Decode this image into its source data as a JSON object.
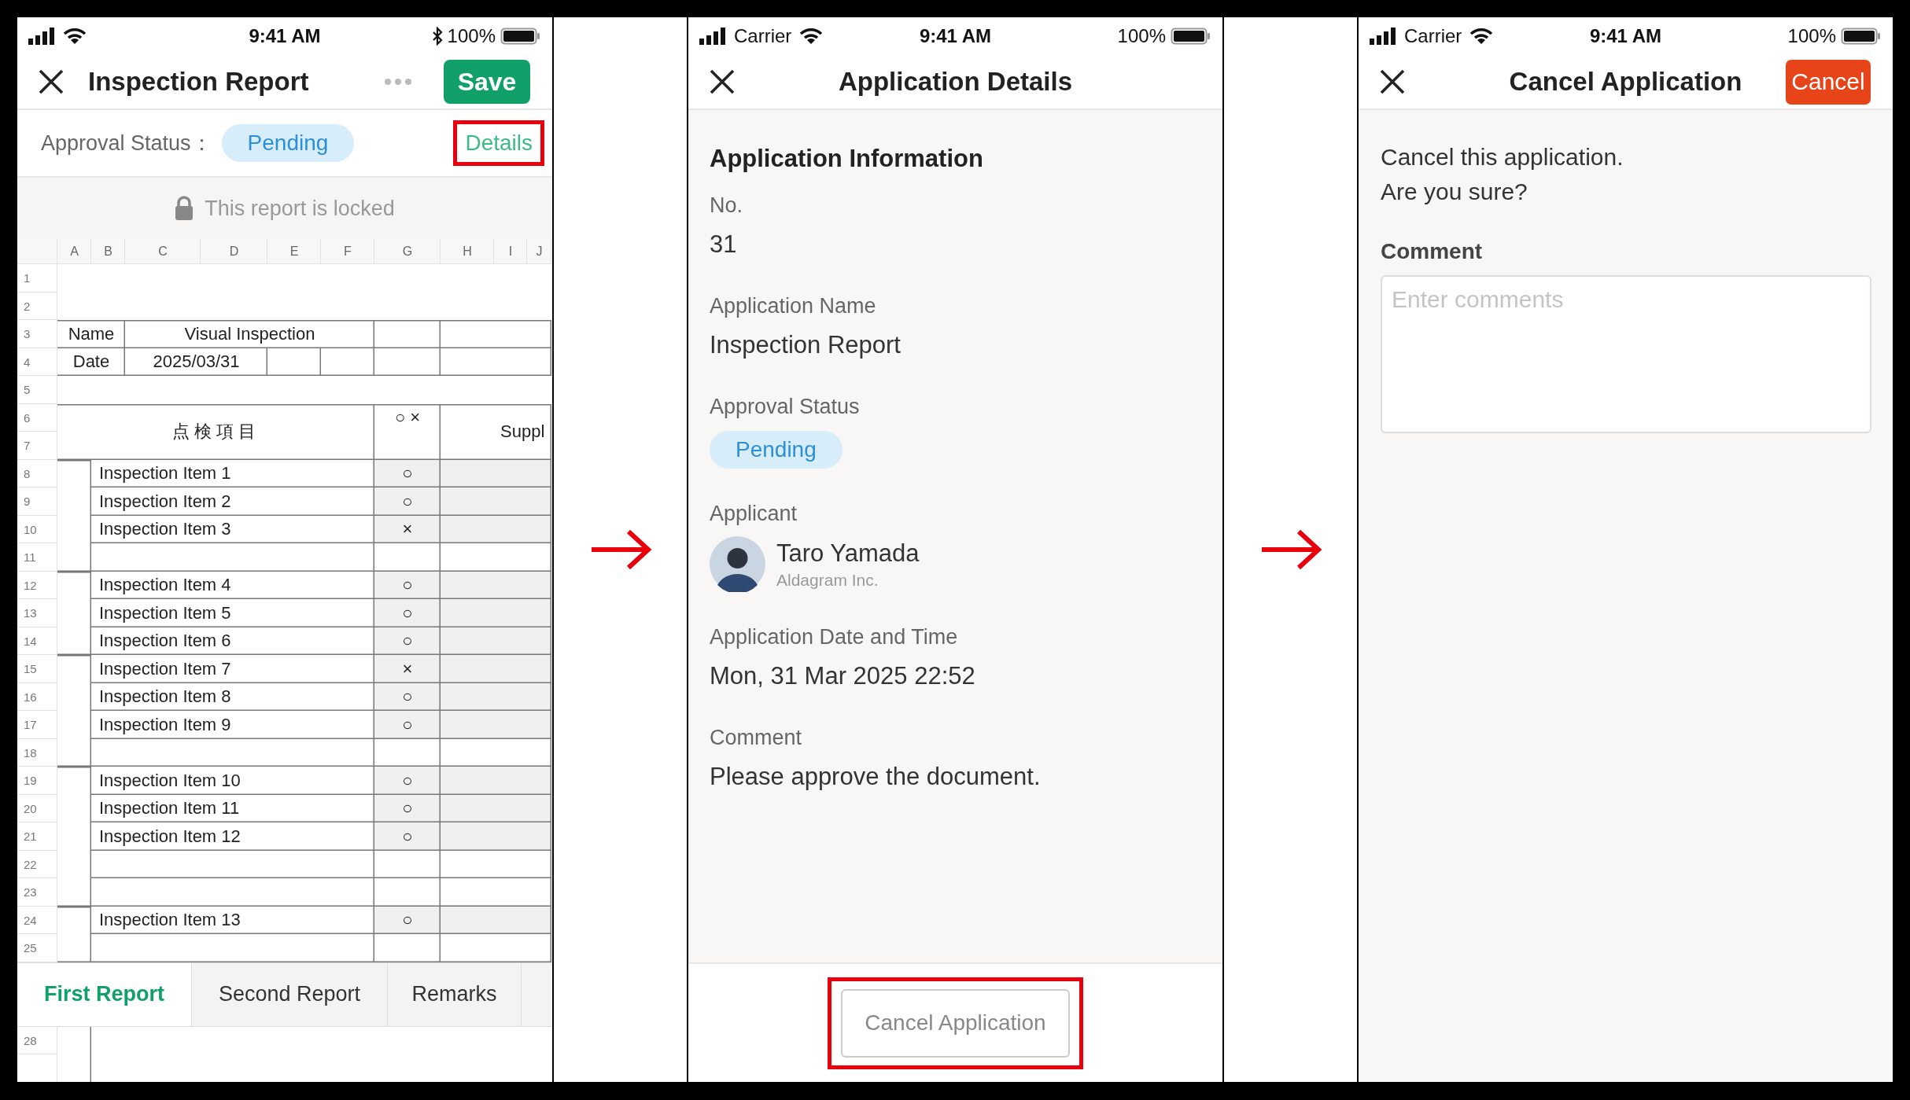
{
  "report_screen": {
    "status_bar": {
      "time": "9:41 AM",
      "battery": "100%",
      "bluetooth": true
    },
    "title": "Inspection Report",
    "save_button": "Save",
    "approval": {
      "label": "Approval Status：",
      "status": "Pending",
      "details_link": {
        "label": "Details",
        "highlighted": true
      }
    },
    "lock_notice": "This report is locked",
    "sheet": {
      "column_headers": [
        "A",
        "B",
        "C",
        "D",
        "E",
        "F",
        "G",
        "H",
        "I",
        "J"
      ],
      "row_numbers": [
        "1",
        "2",
        "3",
        "4",
        "5",
        "6",
        "7",
        "8",
        "9",
        "10",
        "11",
        "12",
        "13",
        "14",
        "15",
        "16",
        "17",
        "18",
        "19",
        "20",
        "21",
        "22",
        "23",
        "24",
        "25"
      ],
      "lower_row_numbers": [
        "28"
      ],
      "name_label": "Name",
      "name_value": "Visual Inspection",
      "date_label": "Date",
      "date_value": "2025/03/31",
      "item_header": "点検項目",
      "result_header": "○ ×",
      "supplement_header": "Suppl",
      "groups": [
        {
          "rows": [
            {
              "kind": "item",
              "label": "Inspection Item 1",
              "result": "○"
            },
            {
              "kind": "item",
              "label": "Inspection Item 2",
              "result": "○"
            },
            {
              "kind": "item",
              "label": "Inspection Item 3",
              "result": "×"
            },
            {
              "kind": "blank"
            }
          ]
        },
        {
          "rows": [
            {
              "kind": "item",
              "label": "Inspection Item 4",
              "result": "○"
            },
            {
              "kind": "item",
              "label": "Inspection Item 5",
              "result": "○"
            },
            {
              "kind": "item",
              "label": "Inspection Item 6",
              "result": "○"
            }
          ]
        },
        {
          "rows": [
            {
              "kind": "item",
              "label": "Inspection Item 7",
              "result": "×"
            },
            {
              "kind": "item",
              "label": "Inspection Item 8",
              "result": "○"
            },
            {
              "kind": "item",
              "label": "Inspection Item 9",
              "result": "○"
            },
            {
              "kind": "blank"
            }
          ]
        },
        {
          "rows": [
            {
              "kind": "item",
              "label": "Inspection Item 10",
              "result": "○"
            },
            {
              "kind": "item",
              "label": "Inspection Item 11",
              "result": "○"
            },
            {
              "kind": "item",
              "label": "Inspection Item 12",
              "result": "○"
            },
            {
              "kind": "blank"
            },
            {
              "kind": "blank"
            }
          ]
        },
        {
          "rows": [
            {
              "kind": "item",
              "label": "Inspection Item 13",
              "result": "○"
            },
            {
              "kind": "blank"
            }
          ]
        }
      ]
    },
    "tabs": [
      {
        "label": "First Report",
        "selected": true
      },
      {
        "label": "Second Report",
        "selected": false
      },
      {
        "label": "Remarks",
        "selected": false
      }
    ]
  },
  "details_screen": {
    "status_bar": {
      "carrier": "Carrier",
      "time": "9:41 AM",
      "battery": "100%"
    },
    "title": "Application Details",
    "section_title": "Application Information",
    "fields": [
      {
        "kind": "text",
        "label": "No.",
        "value": "31"
      },
      {
        "kind": "text",
        "label": "Application Name",
        "value": "Inspection Report"
      },
      {
        "kind": "status",
        "label": "Approval Status",
        "value": "Pending"
      },
      {
        "kind": "person",
        "label": "Applicant",
        "name": "Taro Yamada",
        "organization": "Aldagram Inc."
      },
      {
        "kind": "text",
        "label": "Application Date and Time",
        "value": "Mon, 31 Mar 2025 22:52"
      },
      {
        "kind": "text",
        "label": "Comment",
        "value": "Please approve the document."
      }
    ],
    "cancel_button": {
      "label": "Cancel Application",
      "highlighted": true
    }
  },
  "cancel_screen": {
    "status_bar": {
      "carrier": "Carrier",
      "time": "9:41 AM",
      "battery": "100%"
    },
    "title": "Cancel Application",
    "confirm_button": "Cancel",
    "message_lines": [
      "Cancel this application.",
      "Are you sure?"
    ],
    "comment": {
      "label": "Comment",
      "placeholder": "Enter comments"
    }
  }
}
